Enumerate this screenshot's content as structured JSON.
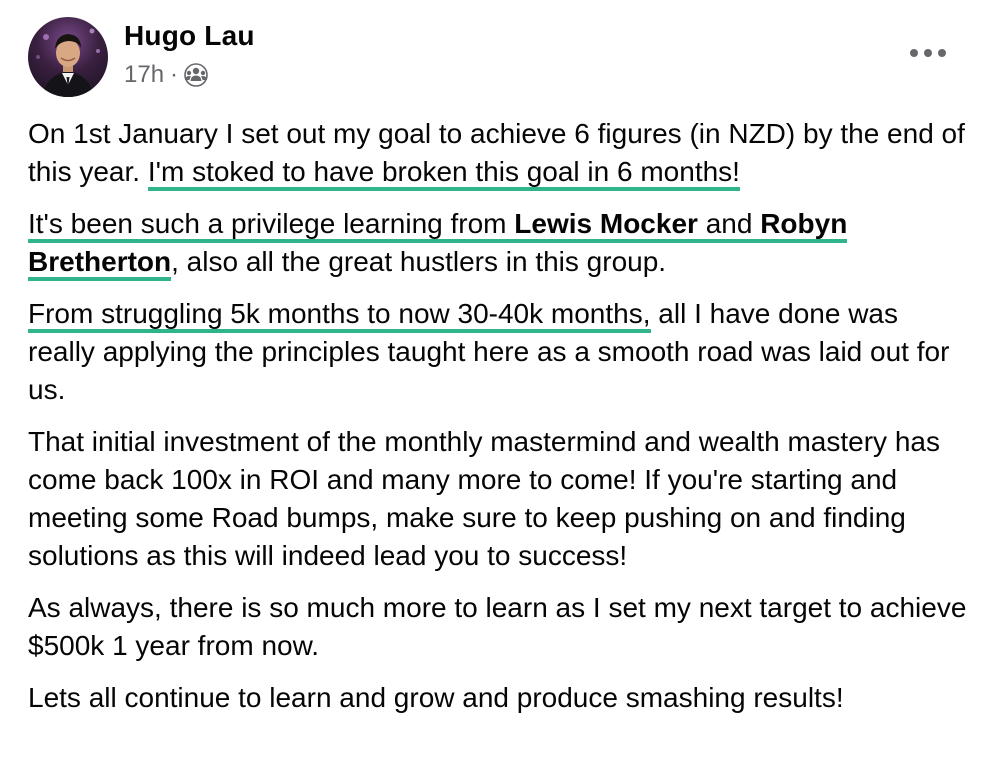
{
  "post": {
    "author": "Hugo Lau",
    "time": "17h",
    "separator": "·",
    "audience_icon": "group-icon",
    "more_icon": "more-options-icon",
    "paragraphs": {
      "p1": {
        "plain": "On 1st January I set out my goal to achieve 6 figures (in NZD) by the end of this year. ",
        "highlight": "I'm stoked to have broken this goal in 6 months!"
      },
      "p2": {
        "hl_a": "It's been such a privilege learning from ",
        "name1": "Lewis Mocker",
        "and": " and ",
        "name2a": "Robyn",
        "name2b": "Bretherton",
        "rest": ", also all the great hustlers in this group."
      },
      "p3": {
        "highlight": "From struggling 5k months to now 30-40k months,",
        "rest": " all I have done was really applying the principles taught here as a smooth road was laid out for us."
      },
      "p4": "That initial investment of the monthly mastermind and wealth mastery has come back 100x in ROI and many more to come! If you're starting and meeting some Road bumps, make sure to keep pushing on and finding solutions as this will indeed lead you to success!",
      "p5": "As always, there is so much more to learn as I set my next target to achieve $500k 1 year from now.",
      "p6": "Lets all continue to learn and grow and produce smashing results!"
    }
  },
  "colors": {
    "underline": "#2fb48c",
    "meta_text": "#65676b",
    "body_text": "#050505"
  }
}
